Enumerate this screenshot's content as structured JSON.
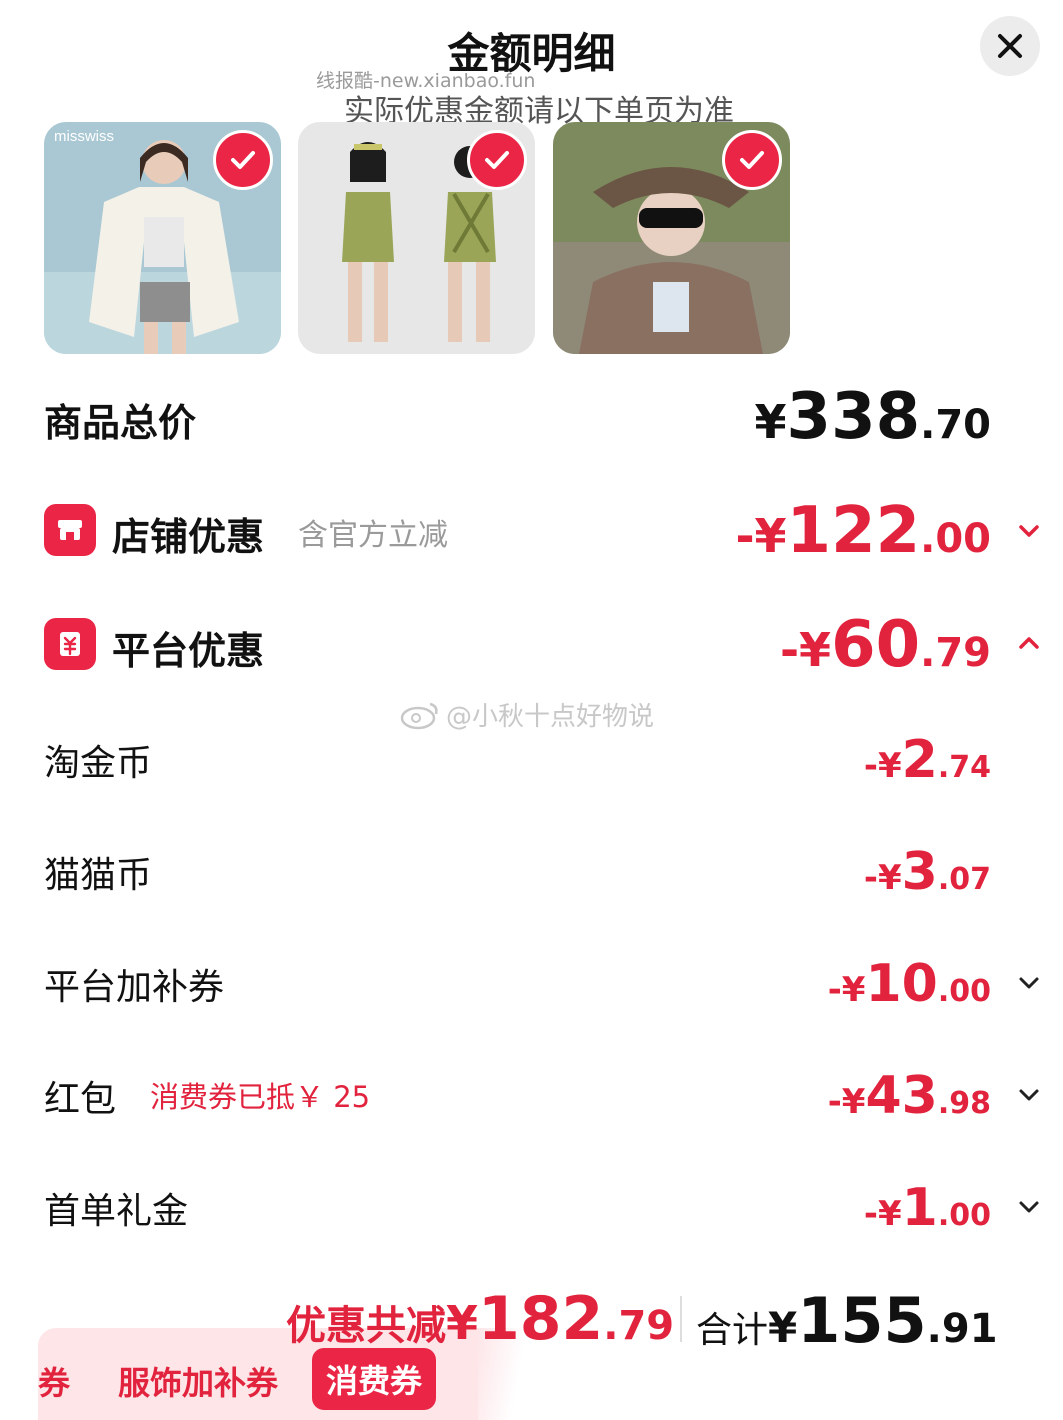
{
  "header": {
    "title": "金额明细",
    "watermark": "线报酷-new.xianbao.fun",
    "subtitle": "实际优惠金额请以下单页为准"
  },
  "products": [
    {
      "name": "product-1",
      "brand": "misswiss",
      "selected": true
    },
    {
      "name": "product-2",
      "selected": true
    },
    {
      "name": "product-3",
      "selected": true
    }
  ],
  "total_price": {
    "label": "商品总价",
    "yen": "¥",
    "int": "338",
    "cents": ".70"
  },
  "store_discount": {
    "label": "店铺优惠",
    "note": "含官方立减",
    "sign": "-¥",
    "int": "122",
    "cents": ".00",
    "expanded": false
  },
  "platform_discount": {
    "label": "平台优惠",
    "sign": "-¥",
    "int": "60",
    "cents": ".79",
    "expanded": true
  },
  "sub_items": [
    {
      "label": "淘金币",
      "note": "",
      "sign": "-¥",
      "int": "2",
      "cents": ".74",
      "has_chevron": false
    },
    {
      "label": "猫猫币",
      "note": "",
      "sign": "-¥",
      "int": "3",
      "cents": ".07",
      "has_chevron": false
    },
    {
      "label": "平台加补券",
      "note": "",
      "sign": "-¥",
      "int": "10",
      "cents": ".00",
      "has_chevron": true
    },
    {
      "label": "红包",
      "note": "消费券已抵￥ 25",
      "sign": "-¥",
      "int": "43",
      "cents": ".98",
      "has_chevron": true
    },
    {
      "label": "首单礼金",
      "note": "",
      "sign": "-¥",
      "int": "1",
      "cents": ".00",
      "has_chevron": true
    }
  ],
  "center_watermark": "@小秋十点好物说",
  "summary": {
    "discount_label": "优惠共减",
    "discount_yen": "¥",
    "discount_int": "182",
    "discount_cents": ".79",
    "total_label": "合计",
    "total_yen": "¥",
    "total_int": "155",
    "total_cents": ".91"
  },
  "bottom_tags": {
    "partial": "券",
    "tag1": "服饰加补券",
    "tag2": "消费券"
  },
  "colors": {
    "accent": "#ea2545",
    "price_red": "#e2233d",
    "bottom_bar": "#fde5e8"
  }
}
